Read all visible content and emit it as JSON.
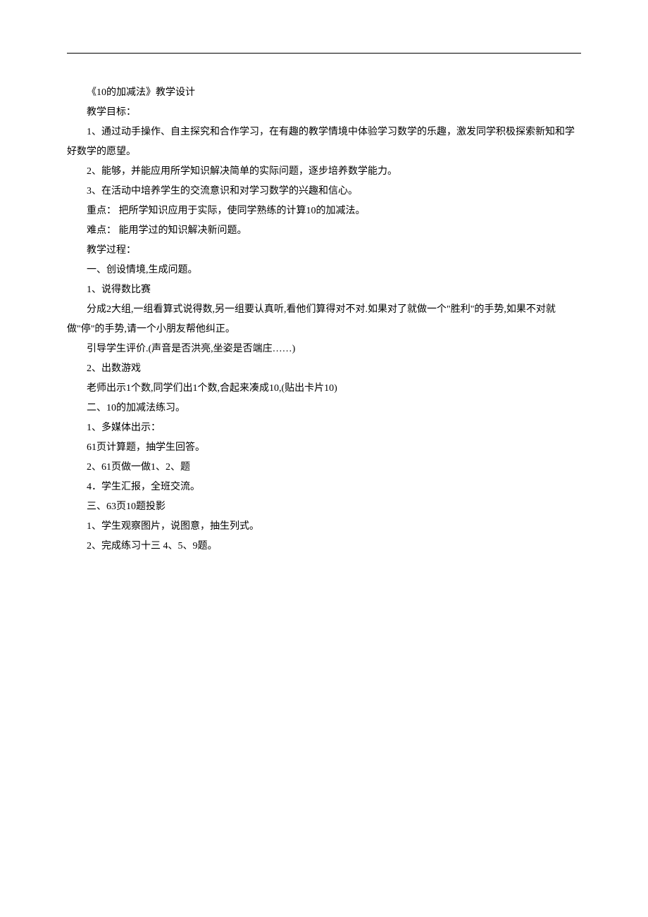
{
  "lines": [
    {
      "text": "《10的加减法》教学设计",
      "indent": true
    },
    {
      "text": "教学目标：",
      "indent": true
    },
    {
      "text": "1、通过动手操作、自主探究和合作学习，在有趣的教学情境中体验学习数学的乐趣，激发同学积极探索新知和学好数学的愿望。",
      "indent": true
    },
    {
      "text": "2、能够，并能应用所学知识解决简单的实际问题，逐步培养数学能力。",
      "indent": true
    },
    {
      "text": "3、在活动中培养学生的交流意识和对学习数学的兴趣和信心。",
      "indent": true
    },
    {
      "text": "重点：  把所学知识应用于实际，使同学熟练的计算10的加减法。",
      "indent": true
    },
    {
      "text": "难点：  能用学过的知识解决新问题。",
      "indent": true
    },
    {
      "text": "教学过程：",
      "indent": true
    },
    {
      "text": "一、创设情境,生成问题。",
      "indent": true
    },
    {
      "text": "1、说得数比赛",
      "indent": true
    },
    {
      "text": "分成2大组,一组看算式说得数,另一组要认真听,看他们算得对不对.如果对了就做一个\"胜利\"的手势,如果不对就做\"停\"的手势,请一个小朋友帮他纠正。",
      "indent": true
    },
    {
      "text": "引导学生评价.(声音是否洪亮,坐姿是否端庄……)",
      "indent": true
    },
    {
      "text": "2、出数游戏",
      "indent": true
    },
    {
      "text": "老师出示1个数,同学们出1个数,合起来凑成10,(贴出卡片10)",
      "indent": true
    },
    {
      "text": "二、10的加减法练习。",
      "indent": true
    },
    {
      "text": "1、多媒体出示：",
      "indent": true
    },
    {
      "text": "61页计算题，抽学生回答。",
      "indent": true
    },
    {
      "text": "2、61页做一做1、2、题",
      "indent": true
    },
    {
      "text": "4．学生汇报，全班交流。",
      "indent": true
    },
    {
      "text": "三、63页10题投影",
      "indent": true
    },
    {
      "text": "1、学生观察图片，说图意，抽生列式。",
      "indent": true
    },
    {
      "text": "2、完成练习十三 4、5、9题。",
      "indent": true
    }
  ]
}
